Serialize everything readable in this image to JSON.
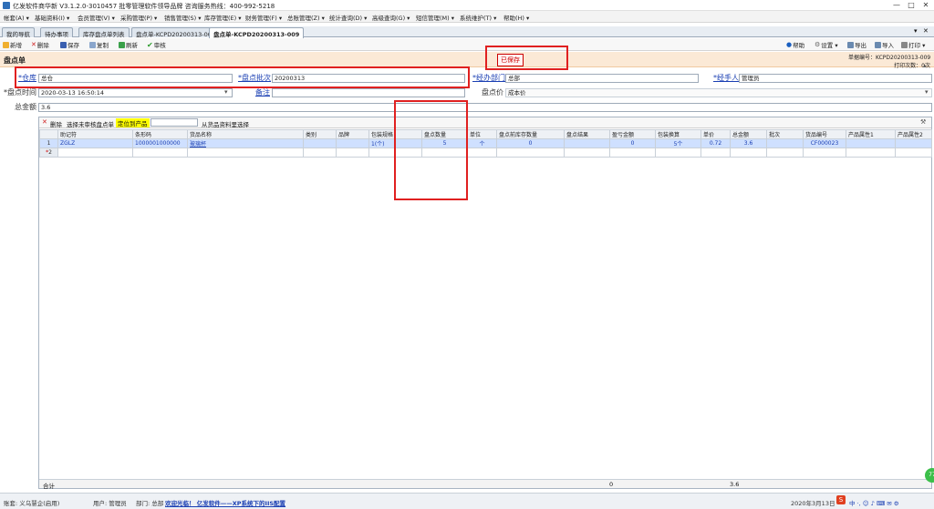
{
  "window": {
    "title": "亿发软件商华新 V3.1.2.0-3010457 批零管理软件领导品牌 咨询服务热线：400-992-5218",
    "minimize": "—",
    "maximize": "□",
    "close": "✕"
  },
  "menus": [
    "帐套(A) ▾",
    "基础资料(I) ▾",
    "会员管理(V) ▾",
    "采购管理(P) ▾",
    "销售管理(S) ▾",
    "库存管理(E) ▾",
    "财务管理(F) ▾",
    "总账管理(Z) ▾",
    "统计查询(D) ▾",
    "高级查询(G) ▾",
    "短信管理(M) ▾",
    "系统维护(T) ▾",
    "帮助(H) ▾"
  ],
  "tabs": [
    "我的导航",
    "待办事项",
    "库存盘点单列表",
    "盘点单-KCPD20200313-008",
    "盘点单-KCPD20200313-009"
  ],
  "toolbar": {
    "add": "新增",
    "delete": "删除",
    "save": "保存",
    "copy": "复制",
    "refresh": "刷新",
    "audit": "审核",
    "help": "帮助",
    "settings": "设置 ▾",
    "export": "导出",
    "import": "导入",
    "print": "打印 ▾"
  },
  "form": {
    "title": "盘点单",
    "status": "已保存",
    "doc_no_label": "单据编号：",
    "doc_no": "KCPD20200313-009",
    "print_count_label": "打印次数：",
    "print_count": "0次",
    "warehouse_label": "*仓库",
    "warehouse": "总仓",
    "batch_label": "*盘点批次",
    "batch": "20200313",
    "dept_label": "*经办部门",
    "dept": "总部",
    "handler_label": "*经手人",
    "handler": "管理员",
    "time_label": "*盘点时间",
    "time": "2020-03-13 16:50:14",
    "remark_label": "备注",
    "remark": "",
    "price_label": "盘点价",
    "price": "成本价",
    "total_label": "总金额",
    "total": "3.6"
  },
  "grid_toolbar": {
    "delete": "删除",
    "select_unaudited": "选择未审核盘点单",
    "locate_label": "定位到产品",
    "locate_value": "",
    "from_archive": "从货品资料里选择"
  },
  "grid": {
    "columns": [
      "助记符",
      "条形码",
      "货品名称",
      "类别",
      "品牌",
      "包装规格",
      "盘点数量",
      "单位",
      "盘点前库存数量",
      "盘点结果",
      "盈亏金额",
      "包装换算",
      "单价",
      "总金额",
      "批次",
      "货品编号",
      "产品属性1",
      "产品属性2"
    ],
    "rows": [
      {
        "num": "1",
        "cells": [
          "ZGLZ",
          "1000001000000",
          "玻璃杯",
          "",
          "",
          "1(个)",
          "5",
          "个",
          "0",
          "",
          "0",
          "5个",
          "0.72",
          "3.6",
          "",
          "CF000023",
          "",
          ""
        ]
      },
      {
        "num": "2",
        "cells": [
          "",
          "",
          "",
          "",
          "",
          "",
          "",
          "",
          "",
          "",
          "",
          "",
          "",
          "",
          "",
          "",
          "",
          ""
        ]
      }
    ],
    "footer_label": "合计",
    "footer_profit": "0",
    "footer_total": "3.6"
  },
  "statusbar": {
    "account": "账套: 义乌慧企(启用)",
    "user": "用户: 管理员",
    "dept": "部门: 总部",
    "promo": "欢迎光临！ 亿发软件——XP系统下的IIS配置",
    "date": "2020年3月13日",
    "tray": "中 ·, ☺ ♪ ⌨ ✉ ⚙"
  },
  "colors": {
    "accent": "#1a3fb3",
    "title_strip": "#fbe9d6",
    "status_red": "#c00000",
    "selected_row": "#cfe0ff"
  }
}
